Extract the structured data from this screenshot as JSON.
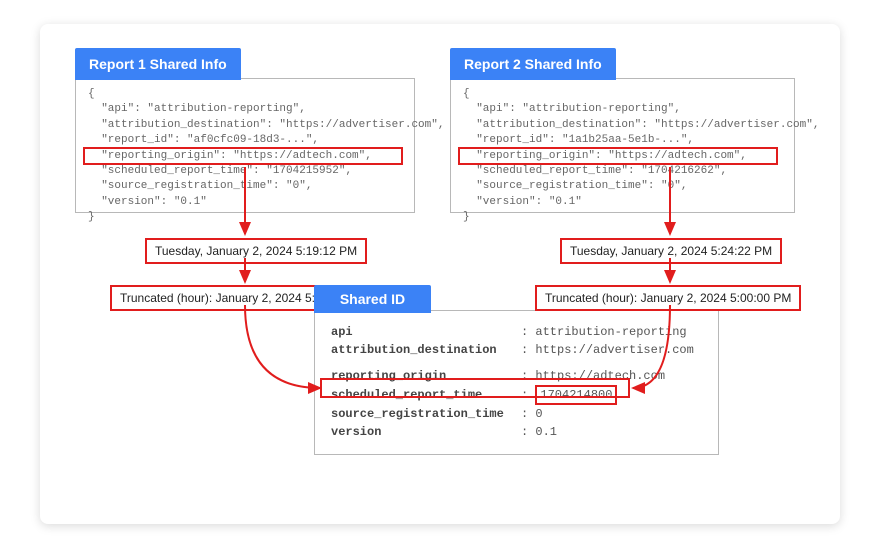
{
  "report1": {
    "tab": "Report 1 Shared Info",
    "line1": "{",
    "line2": "  \"api\": \"attribution-reporting\",",
    "line3": "  \"attribution_destination\": \"https://advertiser.com\",",
    "line4": "  \"report_id\": \"af0cfc09-18d3-...\",",
    "line5": "  \"reporting_origin\": \"https://adtech.com\",",
    "line6": "  \"scheduled_report_time\": \"1704215952\",",
    "line7": "  \"source_registration_time\": \"0\",",
    "line8": "  \"version\": \"0.1\"",
    "line9": "}",
    "datetime": "Tuesday, January 2, 2024 5:19:12 PM",
    "truncated": "Truncated (hour): January 2, 2024 5:00:00 PM"
  },
  "report2": {
    "tab": "Report 2 Shared Info",
    "line1": "{",
    "line2": "  \"api\": \"attribution-reporting\",",
    "line3": "  \"attribution_destination\": \"https://advertiser.com\",",
    "line4": "  \"report_id\": \"1a1b25aa-5e1b-...\",",
    "line5": "  \"reporting_origin\": \"https://adtech.com\",",
    "line6": "  \"scheduled_report_time\": \"1704216262\",",
    "line7": "  \"source_registration_time\": \"0\",",
    "line8": "  \"version\": \"0.1\"",
    "line9": "}",
    "datetime": "Tuesday, January 2, 2024 5:24:22 PM",
    "truncated": "Truncated (hour): January 2, 2024 5:00:00 PM"
  },
  "shared": {
    "tab": "Shared ID",
    "api_k": "api",
    "api_v": "attribution-reporting",
    "dest_k": "attribution_destination",
    "dest_v": "https://advertiser.com",
    "orig_k": "reporting_origin",
    "orig_v": "https://adtech.com",
    "time_k": "scheduled_report_time",
    "time_v": "1704214800",
    "src_k": "source_registration_time",
    "src_v": "0",
    "ver_k": "version",
    "ver_v": "0.1",
    "colon": ":"
  }
}
